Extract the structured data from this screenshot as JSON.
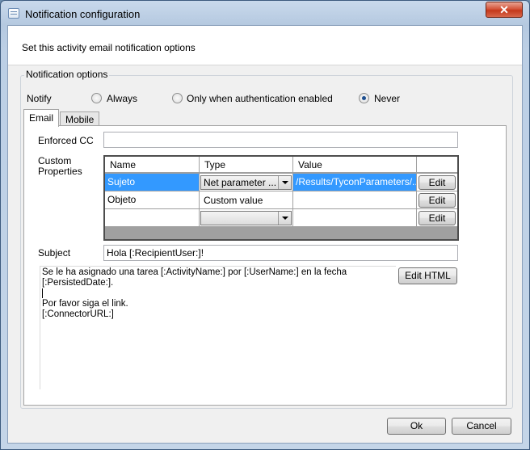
{
  "window": {
    "title": "Notification configuration",
    "close_glyph": "✕"
  },
  "header": {
    "instruction": "Set this activity email notification options"
  },
  "options": {
    "group_label": "Notification options",
    "notify_label": "Notify",
    "radios": [
      {
        "label": "Always",
        "checked": false
      },
      {
        "label": "Only when authentication enabled",
        "checked": false
      },
      {
        "label": "Never",
        "checked": true
      }
    ]
  },
  "tabs": [
    {
      "label": "Email",
      "active": true
    },
    {
      "label": "Mobile",
      "active": false
    }
  ],
  "email": {
    "enforced_cc_label": "Enforced CC",
    "enforced_cc_value": "",
    "custom_properties_label": "Custom Properties",
    "grid": {
      "columns": [
        "Name",
        "Type",
        "Value",
        ""
      ],
      "rows": [
        {
          "name": "Sujeto",
          "type": "Net parameter ...",
          "value": "/Results/TyconParameters/...",
          "edit": "Edit",
          "selected": true
        },
        {
          "name": "Objeto",
          "type": "Custom value",
          "value": "",
          "edit": "Edit",
          "selected": false
        },
        {
          "name": "",
          "type": "",
          "value": "",
          "edit": "Edit",
          "selected": false
        }
      ]
    },
    "subject_label": "Subject",
    "subject_value": "Hola [:RecipientUser:]!",
    "body_lines": [
      "Se le ha asignado una tarea [:ActivityName:] por [:UserName:] en la fecha",
      "[:PersistedDate:].",
      "",
      "Por favor siga el link.",
      "",
      "[:ConnectorURL:]"
    ],
    "edit_html_label": "Edit HTML"
  },
  "footer": {
    "ok_label": "Ok",
    "cancel_label": "Cancel"
  },
  "colors": {
    "selection": "#3399ff",
    "close_button": "#c4381b",
    "title_gradient": "#b5c9e0"
  }
}
